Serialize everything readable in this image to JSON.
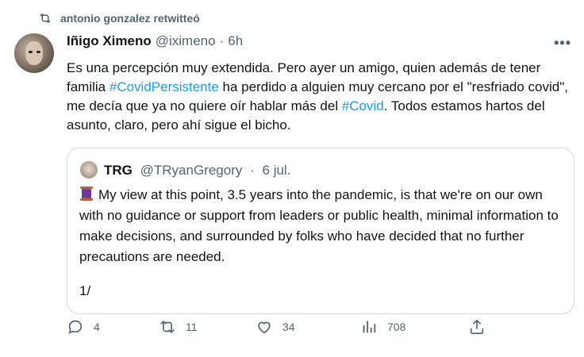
{
  "retweet": {
    "text": "antonio gonzalez retwitteó"
  },
  "tweet": {
    "author_name": "Iñigo Ximeno",
    "handle": "@iximeno",
    "dot": "·",
    "time": "6h",
    "more": "•••",
    "text_parts": {
      "p1": "Es una percepción muy extendida. Pero ayer un amigo, quien además de tener familia ",
      "hashtag1": "#CovidPersistente",
      "p2": " ha perdido a alguien muy cercano por el \"resfriado covid\", me decía que ya no quiere oír hablar más del ",
      "hashtag2": "#Covid",
      "p3": ". Todos estamos hartos del asunto, claro, pero ahí sigue el bicho."
    }
  },
  "quote": {
    "author_name": "TRG",
    "handle": "@TRyanGregory",
    "dot": "·",
    "time": "6 jul.",
    "text": "My view at this point, 3.5 years into the pandemic, is that we're on our own with no guidance or support from leaders or public health, minimal information to make decisions, and surrounded by folks who have decided that no further precautions are needed.",
    "thread_number": "1/"
  },
  "actions": {
    "replies": "4",
    "retweets": "11",
    "likes": "34",
    "views": "708"
  },
  "colors": {
    "accent": "#1d9bf0",
    "secondary_text": "#536471",
    "border": "#cfd9de"
  }
}
